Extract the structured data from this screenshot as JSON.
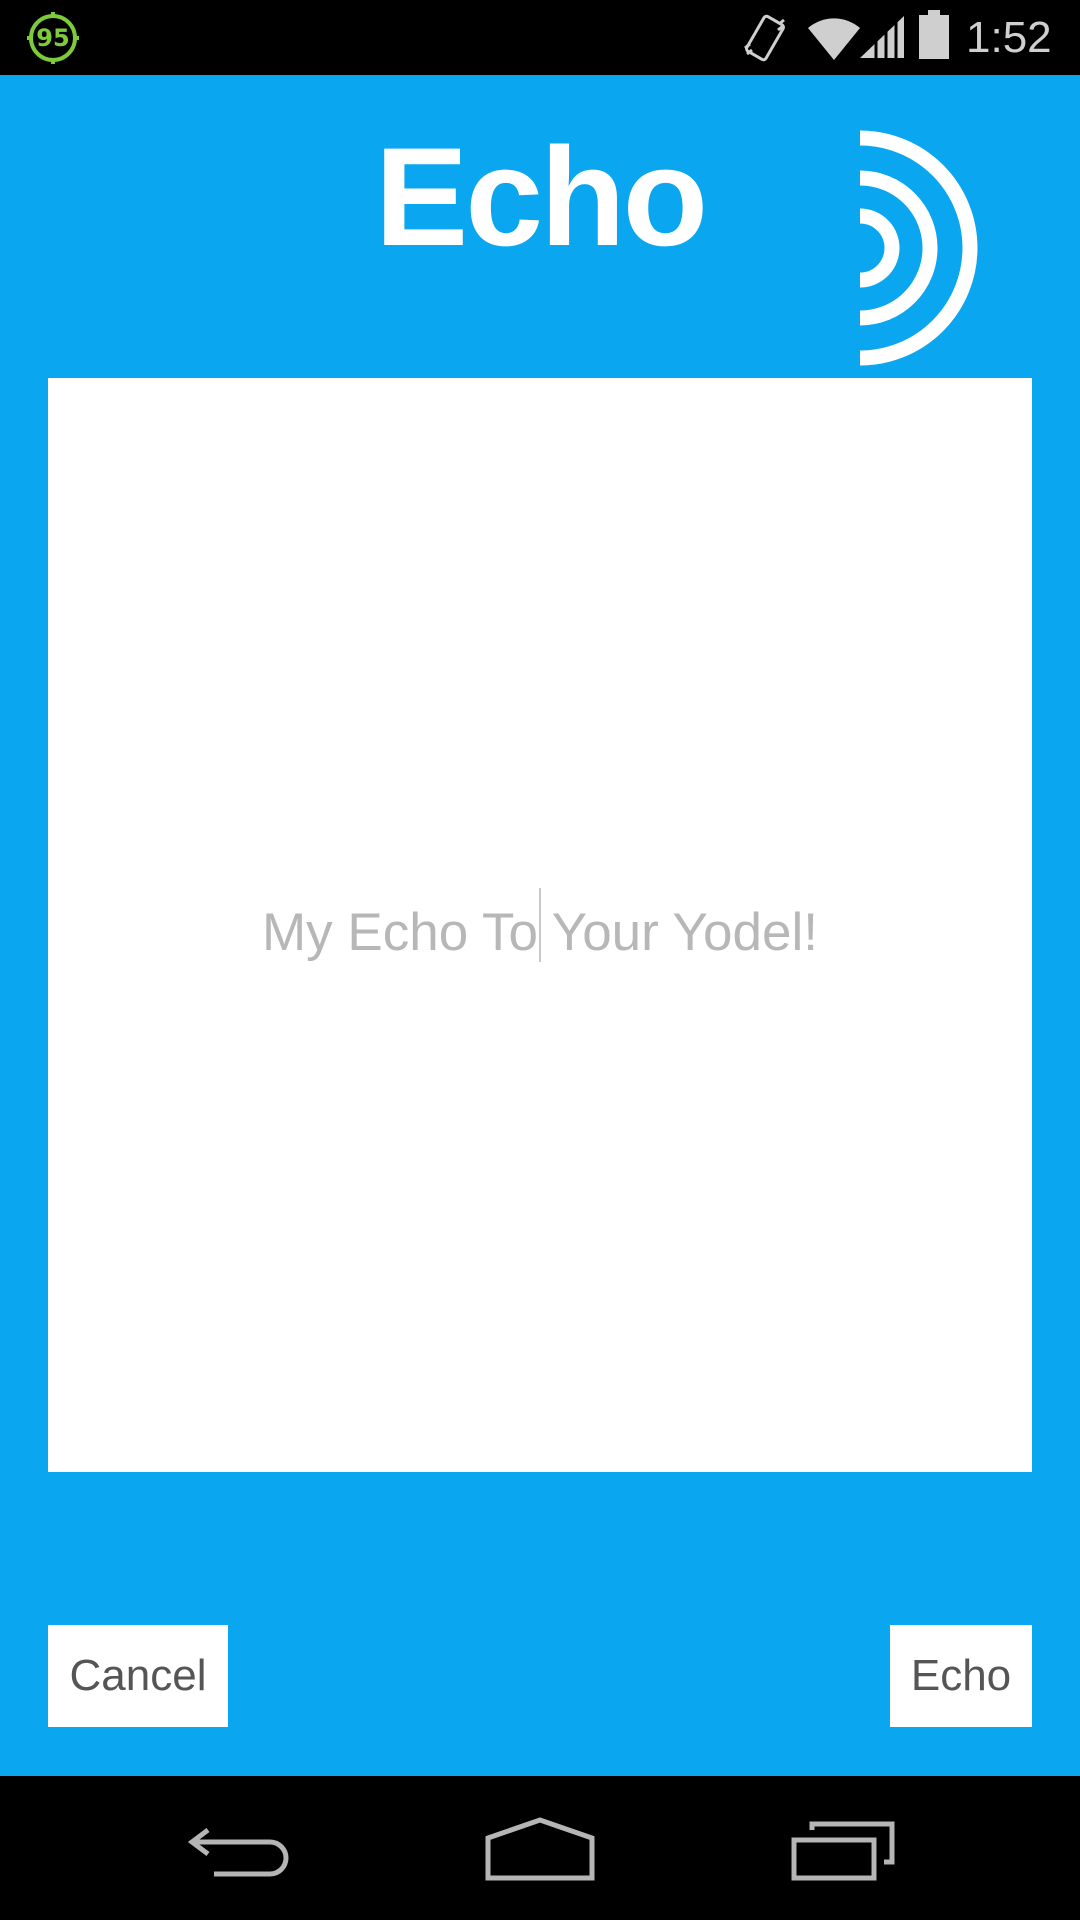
{
  "status_bar": {
    "notification_badge": "95",
    "time": "1:52",
    "icons": [
      "circle-badge-icon",
      "vibrate-icon",
      "wifi-icon",
      "signal-icon",
      "battery-icon"
    ]
  },
  "header": {
    "title": "Echo",
    "logo_icon": "sound-waves-icon"
  },
  "message": {
    "placeholder": "My Echo To Your Yodel!",
    "value": ""
  },
  "actions": {
    "cancel_label": "Cancel",
    "echo_label": "Echo"
  },
  "nav_bar": {
    "icons": [
      "back-icon",
      "home-icon",
      "recents-icon"
    ]
  },
  "colors": {
    "background": "#0aa7f0",
    "panel": "#ffffff",
    "hint_text": "#b7b7b7",
    "button_text": "#555555",
    "system_bars": "#000000"
  }
}
